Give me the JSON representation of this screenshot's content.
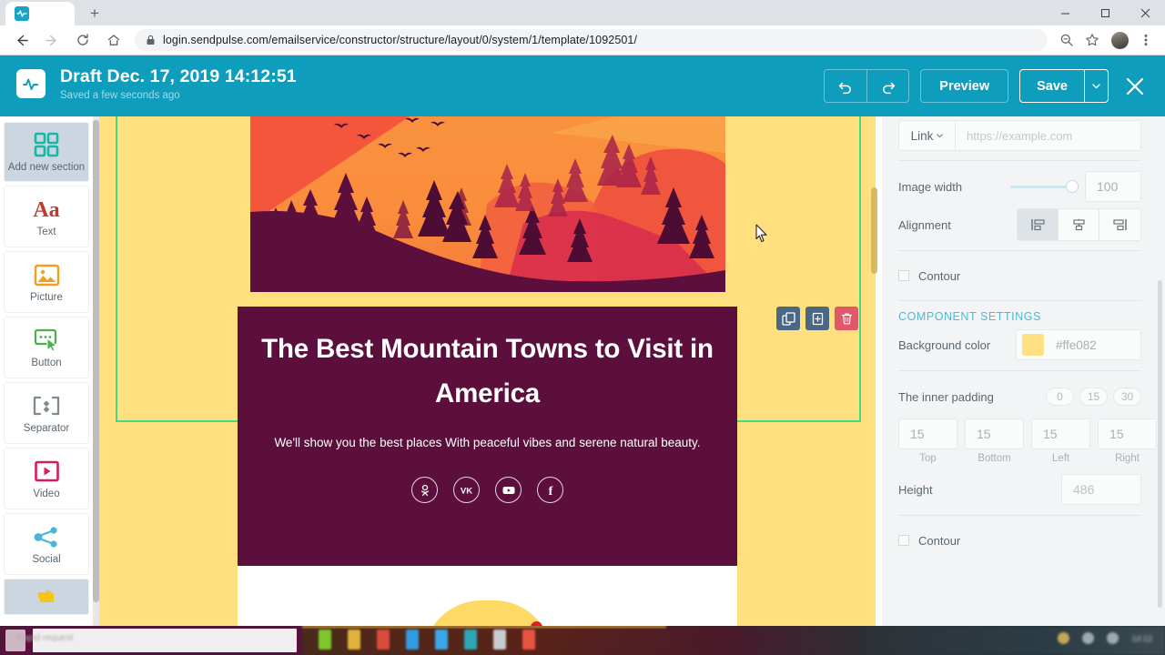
{
  "browser": {
    "tab_favicon": "sendpulse-favicon",
    "new_tab_label": "+",
    "window_minimize": "minimize-icon",
    "window_maximize": "maximize-icon",
    "window_close": "close-icon",
    "back": "back-arrow-icon",
    "forward": "forward-arrow-icon",
    "reload": "reload-icon",
    "home": "home-icon",
    "lock": "lock-icon",
    "url": "login.sendpulse.com/emailservice/constructor/structure/layout/0/system/1/template/1092501/",
    "zoom_icon": "zoom-search-icon",
    "bookmark_icon": "star-icon",
    "profile_icon": "avatar",
    "menu_icon": "kebab-menu-icon"
  },
  "header": {
    "logo": "pulse-logo",
    "title": "Draft Dec. 17, 2019 14:12:51",
    "subtitle": "Saved a few seconds ago",
    "undo_label": "undo-icon",
    "redo_label": "redo-icon",
    "preview_label": "Preview",
    "save_label": "Save",
    "save_caret": "chevron-down-icon",
    "close_label": "close-icon",
    "background_color": "#0e9dbd"
  },
  "sidebar": {
    "items": [
      {
        "label": "Add new section",
        "icon": "grid-four-squares-icon",
        "color": "#14b8a6",
        "active": true
      },
      {
        "label": "Text",
        "icon": "text-aa-icon",
        "color": "#c0392b",
        "active": false
      },
      {
        "label": "Picture",
        "icon": "picture-icon",
        "color": "#f0a01e",
        "active": false
      },
      {
        "label": "Button",
        "icon": "button-cursor-icon",
        "color": "#4caf50",
        "active": false
      },
      {
        "label": "Separator",
        "icon": "separator-icon",
        "color": "#7f8c8d",
        "active": false
      },
      {
        "label": "Video",
        "icon": "video-play-icon",
        "color": "#d81b60",
        "active": false
      },
      {
        "label": "Social",
        "icon": "social-share-icon",
        "color": "#4cb3d9",
        "active": false
      },
      {
        "label": "",
        "icon": "banner-icon",
        "color": "#f5c518",
        "active": true
      }
    ]
  },
  "canvas": {
    "background_color": "#ffdf7e",
    "selection_color": "#3ddc84",
    "hero": {
      "image_alt": "sunset-mountain-forest-illustration",
      "heading": "The Best Mountain Towns to Visit in America",
      "paragraph": "We'll show you the best places With peaceful vibes and serene natural beauty.",
      "block_background": "#5c0f3c",
      "social_icons": [
        {
          "name": "odnoklassniki-icon",
          "glyph": "ok"
        },
        {
          "name": "vk-icon",
          "glyph": "vk"
        },
        {
          "name": "youtube-icon",
          "glyph": "yt"
        },
        {
          "name": "facebook-icon",
          "glyph": "f"
        }
      ]
    },
    "floating_toolbar": [
      {
        "name": "duplicate-block-button",
        "icon": "copy-icon"
      },
      {
        "name": "save-block-button",
        "icon": "save-to-library-icon"
      },
      {
        "name": "delete-block-button",
        "icon": "trash-icon"
      }
    ]
  },
  "settings_panel": {
    "link": {
      "select_label": "Link",
      "caret": "chevron-down-icon",
      "placeholder": "https://example.com",
      "value": ""
    },
    "image_width": {
      "label": "Image width",
      "value": "100",
      "slider_percent": 100
    },
    "alignment": {
      "label": "Alignment",
      "options": [
        {
          "name": "align-left",
          "active": true
        },
        {
          "name": "align-center",
          "active": false
        },
        {
          "name": "align-right",
          "active": false
        }
      ]
    },
    "contour_top": {
      "label": "Contour",
      "checked": false
    },
    "component_settings_title": "COMPONENT SETTINGS",
    "background_color": {
      "label": "Background color",
      "value": "#ffe082",
      "swatch": "#ffe082"
    },
    "inner_padding": {
      "label": "The inner padding",
      "presets": [
        "0",
        "15",
        "30"
      ],
      "fields": [
        {
          "caption": "Top",
          "value": "15"
        },
        {
          "caption": "Bottom",
          "value": "15"
        },
        {
          "caption": "Left",
          "value": "15"
        },
        {
          "caption": "Right",
          "value": "15"
        }
      ]
    },
    "height": {
      "label": "Height",
      "value": "486"
    },
    "contour_bottom": {
      "label": "Contour",
      "checked": false
    }
  },
  "taskbar": {
    "search_text": "Rapid request",
    "clock": "14:12"
  }
}
